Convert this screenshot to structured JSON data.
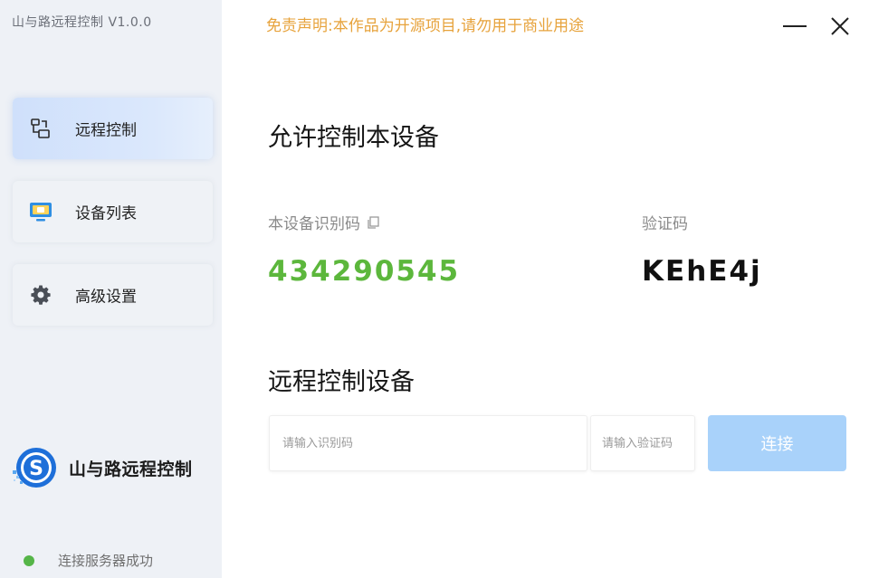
{
  "app": {
    "title": "山与路远程控制 V1.0.0",
    "disclaimer": "免责声明:本作品为开源项目,请勿用于商业用途"
  },
  "window_controls": {
    "minimize_icon": "minimize-icon",
    "close_icon": "close-icon"
  },
  "sidebar": {
    "items": [
      {
        "label": "远程控制",
        "icon": "remote-control-icon",
        "active": true
      },
      {
        "label": "设备列表",
        "icon": "monitor-icon",
        "active": false
      },
      {
        "label": "高级设置",
        "icon": "gear-icon",
        "active": false
      }
    ],
    "brand_name": "山与路远程控制",
    "status_text": "连接服务器成功",
    "status_color": "#55b548"
  },
  "allow": {
    "title": "允许控制本设备",
    "device_id_label": "本设备识别码",
    "device_id": "434290545",
    "verify_label": "验证码",
    "verify_code": "KEhE4j"
  },
  "remote": {
    "title": "远程控制设备",
    "id_input": {
      "value": "",
      "placeholder": "请输入识别码"
    },
    "code_input": {
      "value": "",
      "placeholder": "请输入验证码"
    },
    "connect_label": "连接"
  },
  "colors": {
    "accent": "#a9d2fa",
    "device_id": "#5cb73c",
    "disclaimer": "#e7a33c",
    "sidebar_bg": "#eef1f6"
  }
}
